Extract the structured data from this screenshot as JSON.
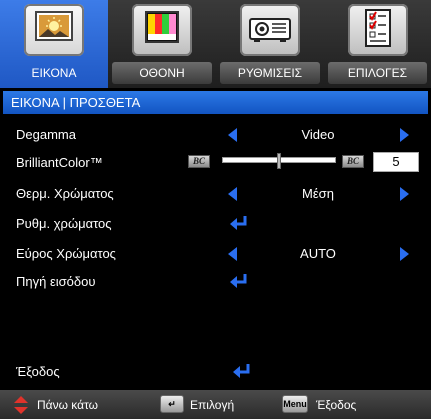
{
  "tabs": [
    {
      "label": "ΕΙΚΟΝΑ",
      "icon": "picture-icon",
      "active": true
    },
    {
      "label": "ΟΘΟΝΗ",
      "icon": "color-bars-icon",
      "active": false
    },
    {
      "label": "ΡΥΘΜΙΣΕΙΣ",
      "icon": "projector-icon",
      "active": false
    },
    {
      "label": "ΕΠΙΛΟΓΕΣ",
      "icon": "checklist-icon",
      "active": false
    }
  ],
  "title": "ΕΙΚΟΝΑ | ΠΡΟΣΘΕΤΑ",
  "rows": {
    "degamma": {
      "label": "Degamma",
      "value": "Video"
    },
    "brilliant": {
      "label": "BrilliantColor™",
      "bc_left": "BC",
      "bc_right": "BC",
      "value": "5",
      "level": 0.5
    },
    "color_temp": {
      "label": "Θερμ. Χρώματος",
      "value": "Μέση"
    },
    "color_setting": {
      "label": "Ρυθμ. χρώματος"
    },
    "color_space": {
      "label": "Εύρος Χρώματος",
      "value": "AUTO"
    },
    "input_source": {
      "label": "Πηγή εισόδου"
    },
    "exit": {
      "label": "Έξοδος"
    }
  },
  "footer": {
    "updown": "Πάνω κάτω",
    "enter_key": "↵",
    "select": "Επιλογή",
    "menu_key": "Menu",
    "exit": "Έξοδος"
  },
  "colors": {
    "accent": "#2a6ef0",
    "active_tab": "#2c6fe0",
    "background": "#000000"
  }
}
